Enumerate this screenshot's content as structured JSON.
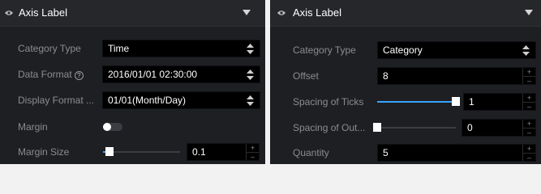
{
  "left": {
    "title": "Axis Label",
    "category_type": {
      "label": "Category Type",
      "value": "Time"
    },
    "data_format": {
      "label": "Data Format",
      "value": "2016/01/01 02:30:00"
    },
    "display_format": {
      "label": "Display Format ...",
      "value": "01/01(Month/Day)"
    },
    "margin": {
      "label": "Margin",
      "enabled": false
    },
    "margin_size": {
      "label": "Margin Size",
      "value": "0.1",
      "slider_fraction": 0.1
    }
  },
  "right": {
    "title": "Axis Label",
    "category_type": {
      "label": "Category Type",
      "value": "Category"
    },
    "offset": {
      "label": "Offset",
      "value": "8"
    },
    "spacing_of_ticks": {
      "label": "Spacing of Ticks",
      "value": "1",
      "slider_fraction": 1.0
    },
    "spacing_of_out": {
      "label": "Spacing of Out...",
      "value": "0",
      "slider_fraction": 0.0
    },
    "quantity": {
      "label": "Quantity",
      "value": "5"
    }
  },
  "help_glyph": "?",
  "stepper": {
    "up": "+",
    "down": "–"
  },
  "icons": {
    "eye": "eye-icon",
    "caret": "caret-down-icon",
    "select_arrows": "select-arrows-icon",
    "help": "help-icon"
  },
  "colors": {
    "accent": "#3aa2ff",
    "panel_bg": "#1e1f22",
    "header_bg": "#26272b",
    "input_bg": "#000000",
    "label": "#8a8c90"
  }
}
